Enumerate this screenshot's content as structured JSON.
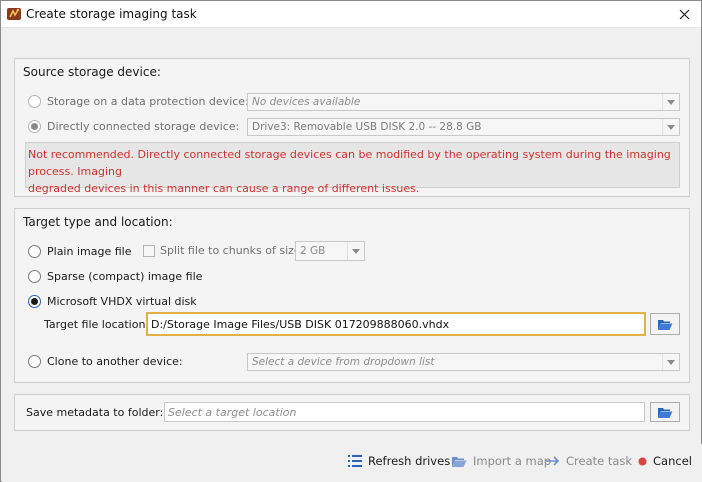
{
  "window": {
    "title": "Create storage imaging task"
  },
  "source": {
    "title": "Source storage device:",
    "protection_label": "Storage on a data protection device:",
    "protection_placeholder": "No devices available",
    "direct_label": "Directly connected storage device:",
    "direct_value": "Drive3: Removable USB DISK 2.0 -- 28.8 GB",
    "warning_line1": "Not recommended. Directly connected storage devices can be modified by the operating system during the imaging process. Imaging",
    "warning_line2": "degraded devices in this manner can cause a range of different issues."
  },
  "target": {
    "title": "Target type and location:",
    "plain_label": "Plain image file",
    "split_label": "Split file to chunks of size:",
    "split_value": "2 GB",
    "sparse_label": "Sparse (compact) image file",
    "vhdx_label": "Microsoft VHDX virtual disk",
    "file_location_label": "Target file location:",
    "file_location_value": "D:/Storage Image Files/USB DISK 017209888060.vhdx",
    "clone_label": "Clone to another device:",
    "clone_placeholder": "Select a device from dropdown list"
  },
  "metadata": {
    "label": "Save metadata to folder:",
    "placeholder": "Select a target location"
  },
  "footer": {
    "refresh": "Refresh drives",
    "import": "Import a map",
    "create": "Create task",
    "cancel": "Cancel"
  },
  "colors": {
    "warning": "#d0312d",
    "focus_border": "#e0b04a",
    "accent_blue": "#2a62b8"
  }
}
